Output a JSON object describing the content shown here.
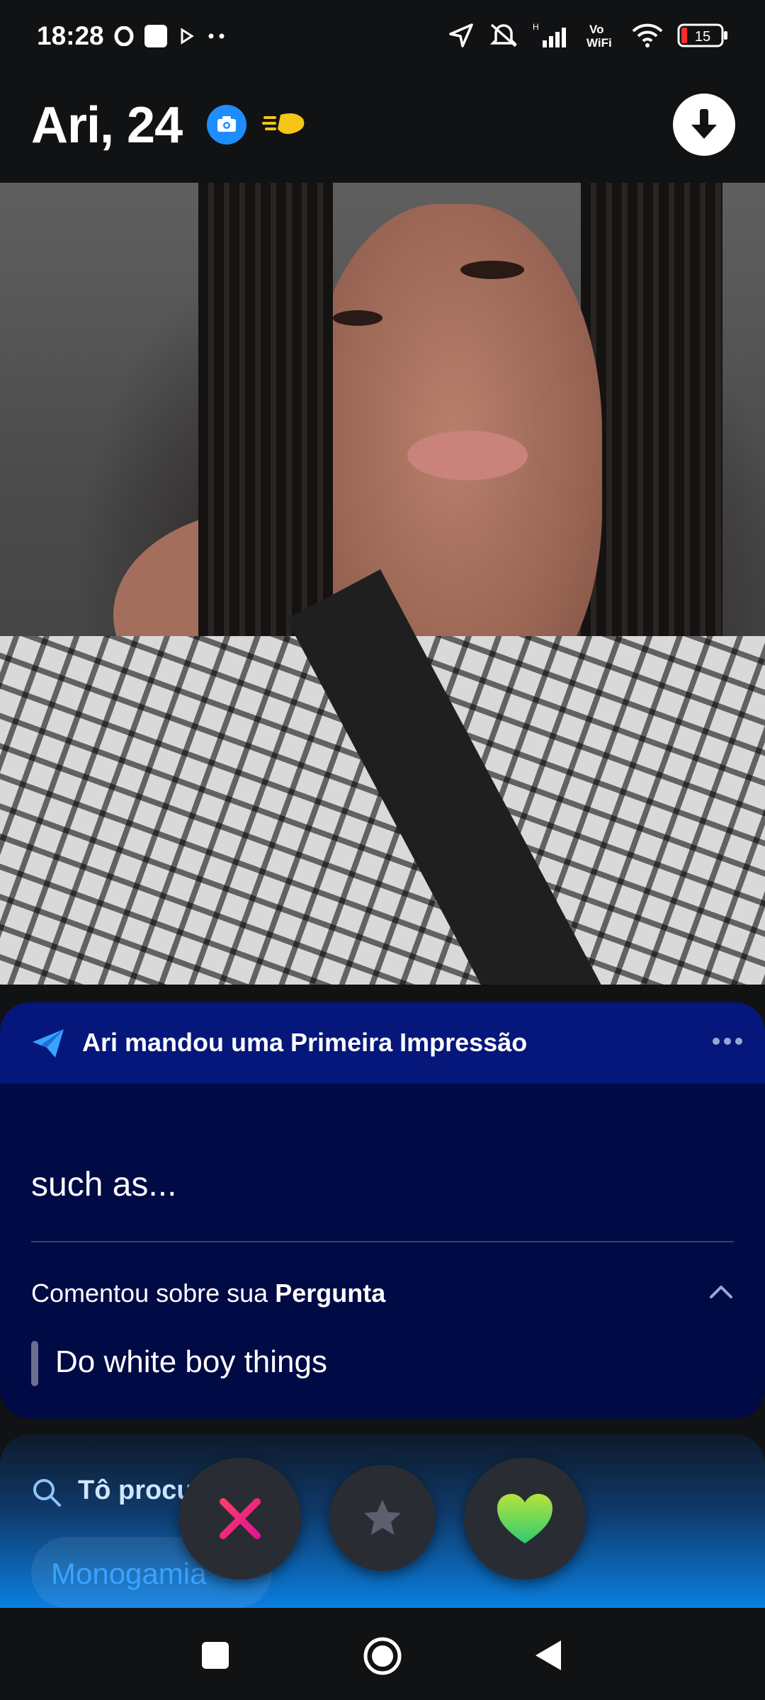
{
  "status_bar": {
    "time": "18:28",
    "battery": "15",
    "network": "H",
    "wifi_label_top": "Vo",
    "wifi_label_bottom": "WiFi"
  },
  "header": {
    "name_age": "Ari, 24"
  },
  "first_impression": {
    "title": "Ari mandou uma Primeira Impressão",
    "message": "such as...",
    "comment_prefix": "Comentou sobre sua ",
    "comment_target": "Pergunta",
    "quote": "Do white boy things"
  },
  "looking_for": {
    "label": "Tô procu",
    "chip": "Monogamia"
  },
  "colors": {
    "accent_blue": "#1f8cff",
    "nope_pink": "#ff2d8a",
    "like_green": "#4cd964",
    "card_bg": "#000a45"
  }
}
